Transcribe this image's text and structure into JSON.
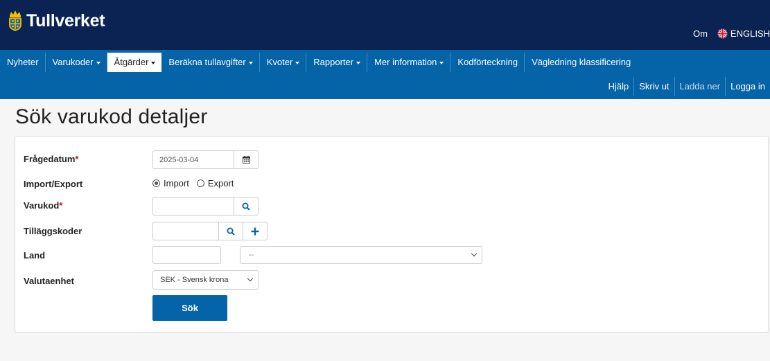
{
  "brand": {
    "name": "Tullverket"
  },
  "top_links": {
    "about": "Om",
    "language": "ENGLISH"
  },
  "nav": {
    "items": [
      {
        "label": "Nyheter",
        "dropdown": false,
        "active": false
      },
      {
        "label": "Varukoder",
        "dropdown": true,
        "active": false
      },
      {
        "label": "Åtgärder",
        "dropdown": true,
        "active": true
      },
      {
        "label": "Beräkna tullavgifter",
        "dropdown": true,
        "active": false
      },
      {
        "label": "Kvoter",
        "dropdown": true,
        "active": false
      },
      {
        "label": "Rapporter",
        "dropdown": true,
        "active": false
      },
      {
        "label": "Mer information",
        "dropdown": true,
        "active": false
      },
      {
        "label": "Kodförteckning",
        "dropdown": false,
        "active": false
      },
      {
        "label": "Vägledning klassificering",
        "dropdown": false,
        "active": false
      }
    ],
    "secondary": [
      {
        "label": "Hjälp"
      },
      {
        "label": "Skriv ut"
      },
      {
        "label": "Ladda ner"
      },
      {
        "label": "Logga in"
      }
    ]
  },
  "page": {
    "title": "Sök varukod detaljer"
  },
  "form": {
    "query_date": {
      "label": "Frågedatum",
      "required_mark": "*",
      "value": "2025-03-04",
      "icon": "calendar-icon"
    },
    "direction": {
      "label": "Import/Export",
      "options": [
        "Import",
        "Export"
      ],
      "selected": "Import"
    },
    "goods_code": {
      "label": "Varukod",
      "required_mark": "*",
      "value": "",
      "icon": "search-icon"
    },
    "additional_codes": {
      "label": "Tilläggskoder",
      "value": "",
      "icons": [
        "search-icon",
        "plus-icon"
      ]
    },
    "country": {
      "label": "Land",
      "code_value": "",
      "select_value": "--"
    },
    "currency": {
      "label": "Valutaenhet",
      "value": "SEK - Svensk krona"
    },
    "submit_label": "Sök"
  },
  "colors": {
    "header": "#0a2352",
    "nav": "#0563a7",
    "accent": "#0563a7",
    "required": "#d0021b"
  }
}
